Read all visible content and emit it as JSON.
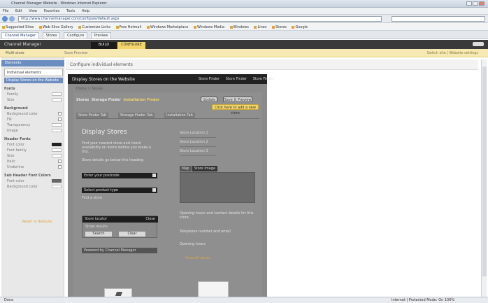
{
  "browser": {
    "window_title": "Channel Manager Website - Windows Internet Explorer",
    "menu": [
      "File",
      "Edit",
      "View",
      "Favorites",
      "Tools",
      "Help"
    ],
    "address": "http://www.channelmanager.com/configure/default.aspx",
    "bookmarks": [
      "Suggested Sites",
      "Web Slice Gallery",
      "Customize Links",
      "Free Hotmail",
      "Windows Marketplace",
      "Windows Media",
      "Windows",
      "Lines",
      "Stores",
      "Google"
    ],
    "tabs": [
      "Channel Manager",
      "Stores",
      "Configure",
      "Preview"
    ],
    "status_left": "Done",
    "status_right": "Internet | Protected Mode: On    100%"
  },
  "app": {
    "logo": "Channel Manager",
    "tab_build": "BUILD",
    "tab_configure": "CONFIGURE",
    "site_name": "Multi-store",
    "subhead_actions": "Save  Preview",
    "subhead_right": "Switch site  |  Website settings",
    "page_title": "Configure individual elements"
  },
  "sidebar": {
    "accordion": "Elements",
    "selected": "Individual elements",
    "selected2": "Display Stores on the Website",
    "sections": [
      {
        "title": "Fonts",
        "rows": [
          "Family",
          "Size"
        ]
      },
      {
        "title": "Background",
        "rows": [
          "Background color",
          "Fill",
          "Transparency",
          "Image"
        ]
      },
      {
        "title": "Header Fonts",
        "rows": [
          "Font color",
          "Font family",
          "Size",
          "Italic",
          "Underline"
        ]
      },
      {
        "title": "Sub Header Font Colors",
        "rows": [
          "Font color",
          "Background color"
        ]
      }
    ],
    "bottom_link": "Reset to defaults"
  },
  "preview": {
    "site_title": "Display Stores on the Website",
    "nav": [
      "Store Finder",
      "Store Finder",
      "Store Finder"
    ],
    "breadcrumb": "Home  >  Stores",
    "stores_label": "Stores",
    "stores_sub": "Storage Finder",
    "stores_hl": "Installation Finder",
    "btn_update": "Update",
    "btn_save": "Save & Preview",
    "btn_cta": "Click here to add a new store",
    "tabs": [
      "Store Finder Tab",
      "Storage Finder Tab",
      "Installation Tab"
    ],
    "heading": "Display Stores",
    "intro": "Find your nearest store and check availability on items before you make a trip.",
    "label": "Store details go below this heading",
    "input1": "Enter your postcode",
    "input2": "Select product type",
    "note": "Find a store",
    "box_title": "Store locator",
    "box_right": "Close",
    "box_row": "Show results",
    "box_btn1": "Search",
    "box_btn2": "Clear",
    "bar_text": "Powered by Channel Manager",
    "right_links": [
      "Store Location 1",
      "Store Location 2",
      "Store Location 3"
    ],
    "image_tabs": [
      "Map",
      "Store Image"
    ],
    "right_text1": "Opening hours and contact details for this store.",
    "right_text2": "Telephone number and email",
    "right_text3": "Opening hours",
    "right_link": "View all stores"
  }
}
